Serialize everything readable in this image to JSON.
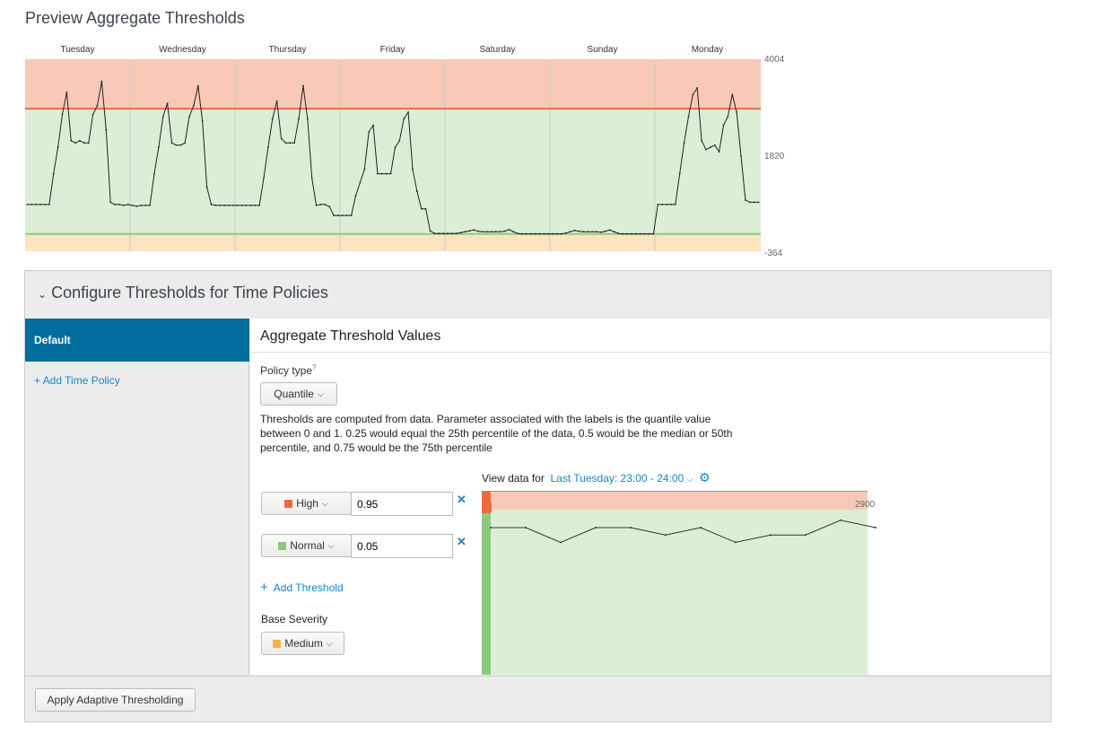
{
  "title": "Preview Aggregate Thresholds",
  "preview_chart": {
    "chart_data": {
      "type": "line",
      "categories": [
        "Tuesday",
        "Wednesday",
        "Thursday",
        "Friday",
        "Saturday",
        "Sunday",
        "Monday"
      ],
      "ylim": [
        -364,
        4004
      ],
      "yticks": [
        "4004",
        "1820",
        "-364"
      ],
      "thresholds": {
        "high": 2880,
        "normal": 30
      },
      "bands": [
        {
          "severity": "High",
          "color": "#f9c9b8"
        },
        {
          "severity": "Normal",
          "color": "#dcefd6"
        },
        {
          "severity": "Medium",
          "color": "#fde4c0"
        }
      ],
      "threshold_colors": {
        "high": "#ec6a3a",
        "normal": "#8ccb7c"
      },
      "series": [
        {
          "values": [
            700,
            700,
            700,
            700,
            700,
            700,
            1400,
            2000,
            2750,
            3250,
            2150,
            2100,
            2150,
            2100,
            2100,
            2750,
            2950,
            3500,
            2400,
            750,
            700,
            700,
            680,
            700,
            680,
            660,
            680,
            680,
            680,
            1400,
            2000,
            2700,
            3000,
            2100,
            2050,
            2050,
            2100,
            2700,
            2950,
            3400,
            2600,
            1100,
            700,
            680,
            680,
            680,
            680,
            680,
            680,
            680,
            680,
            680,
            680,
            680,
            1300,
            2000,
            2650,
            3050,
            2200,
            2100,
            2100,
            2100,
            2650,
            3400,
            2650,
            1300,
            680,
            700,
            700,
            650,
            450,
            450,
            450,
            450,
            450,
            900,
            1200,
            1500,
            2350,
            2500,
            1400,
            1400,
            1400,
            1400,
            2000,
            2150,
            2650,
            2800,
            1500,
            1000,
            600,
            600,
            100,
            40,
            40,
            40,
            40,
            40,
            40,
            60,
            80,
            100,
            120,
            90,
            80,
            80,
            80,
            80,
            80,
            90,
            130,
            80,
            40,
            30,
            30,
            30,
            30,
            30,
            30,
            30,
            30,
            30,
            30,
            50,
            80,
            110,
            90,
            80,
            80,
            80,
            80,
            70,
            90,
            120,
            80,
            40,
            30,
            30,
            30,
            30,
            30,
            30,
            30,
            30,
            700,
            700,
            700,
            700,
            700,
            1400,
            2100,
            2700,
            3200,
            3350,
            2150,
            1950,
            2000,
            2050,
            1900,
            2500,
            2700,
            3200,
            2800,
            1800,
            800,
            750,
            750,
            750
          ]
        }
      ]
    }
  },
  "config": {
    "header": "Configure Thresholds for Time Policies",
    "sidebar": {
      "selected": "Default",
      "add_policy": "+ Add Time Policy"
    },
    "main": {
      "header": "Aggregate Threshold Values",
      "policy_type_label": "Policy type",
      "help_mark": "?",
      "policy_type_value": "Quantile",
      "description": "Thresholds are computed from data. Parameter associated with the labels is the quantile value between 0 and 1. 0.25 would equal the 25th percentile of the data, 0.5 would be the median or 50th percentile, and 0.75 would be the 75th percentile",
      "view_data_label": "View data for",
      "view_data_value": "Last Tuesday: 23:00 - 24:00",
      "thresholds": [
        {
          "severity": "High",
          "color": "#ec6a3a",
          "value": "0.95"
        },
        {
          "severity": "Normal",
          "color": "#8ccb7c",
          "value": "0.05"
        }
      ],
      "add_threshold": "Add Threshold",
      "base_severity_label": "Base Severity",
      "base_severity": {
        "severity": "Medium",
        "color": "#f8b04c"
      },
      "detail_chart": {
        "chart_data": {
          "type": "line",
          "label": "2900",
          "values": [
            0.2,
            0.2,
            0.18,
            0.2,
            0.2,
            0.19,
            0.2,
            0.18,
            0.19,
            0.19,
            0.21,
            0.2
          ]
        }
      }
    },
    "apply_button": "Apply Adaptive Thresholding"
  },
  "colors": {
    "accent": "#1e82c8",
    "selected": "#006d9c"
  }
}
